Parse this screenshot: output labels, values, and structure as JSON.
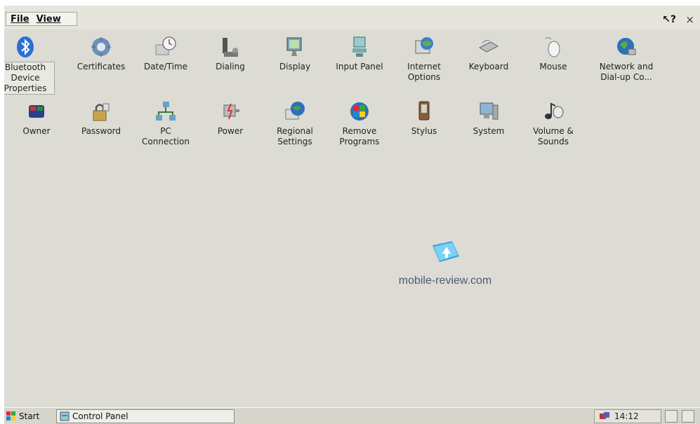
{
  "menu": {
    "file": "File",
    "view": "View"
  },
  "titlebar": {
    "help": "?",
    "close": "×"
  },
  "row1": [
    {
      "label": "Bluetooth Device Properties",
      "icon": "bluetooth-icon"
    },
    {
      "label": "Certificates",
      "icon": "certificates-icon"
    },
    {
      "label": "Date/Time",
      "icon": "date-time-icon"
    },
    {
      "label": "Dialing",
      "icon": "dialing-icon"
    },
    {
      "label": "Display",
      "icon": "display-icon"
    },
    {
      "label": "Input Panel",
      "icon": "input-panel-icon"
    },
    {
      "label": "Internet Options",
      "icon": "internet-options-icon"
    },
    {
      "label": "Keyboard",
      "icon": "keyboard-icon"
    },
    {
      "label": "Mouse",
      "icon": "mouse-icon"
    },
    {
      "label": "Network and Dial-up Co...",
      "icon": "network-icon"
    }
  ],
  "row2": [
    {
      "label": "Owner",
      "icon": "owner-icon"
    },
    {
      "label": "Password",
      "icon": "password-icon"
    },
    {
      "label": "PC Connection",
      "icon": "pc-connection-icon"
    },
    {
      "label": "Power",
      "icon": "power-icon"
    },
    {
      "label": "Regional Settings",
      "icon": "regional-settings-icon"
    },
    {
      "label": "Remove Programs",
      "icon": "remove-programs-icon"
    },
    {
      "label": "Stylus",
      "icon": "stylus-icon"
    },
    {
      "label": "System",
      "icon": "system-icon"
    },
    {
      "label": "Volume & Sounds",
      "icon": "volume-sounds-icon"
    }
  ],
  "watermark": "mobile-review.com",
  "taskbar": {
    "start": "Start",
    "task": "Control Panel",
    "clock": "14:12"
  },
  "colors": {
    "accent_blue": "#2a6fd6",
    "desktop": "#dcdcd5"
  }
}
